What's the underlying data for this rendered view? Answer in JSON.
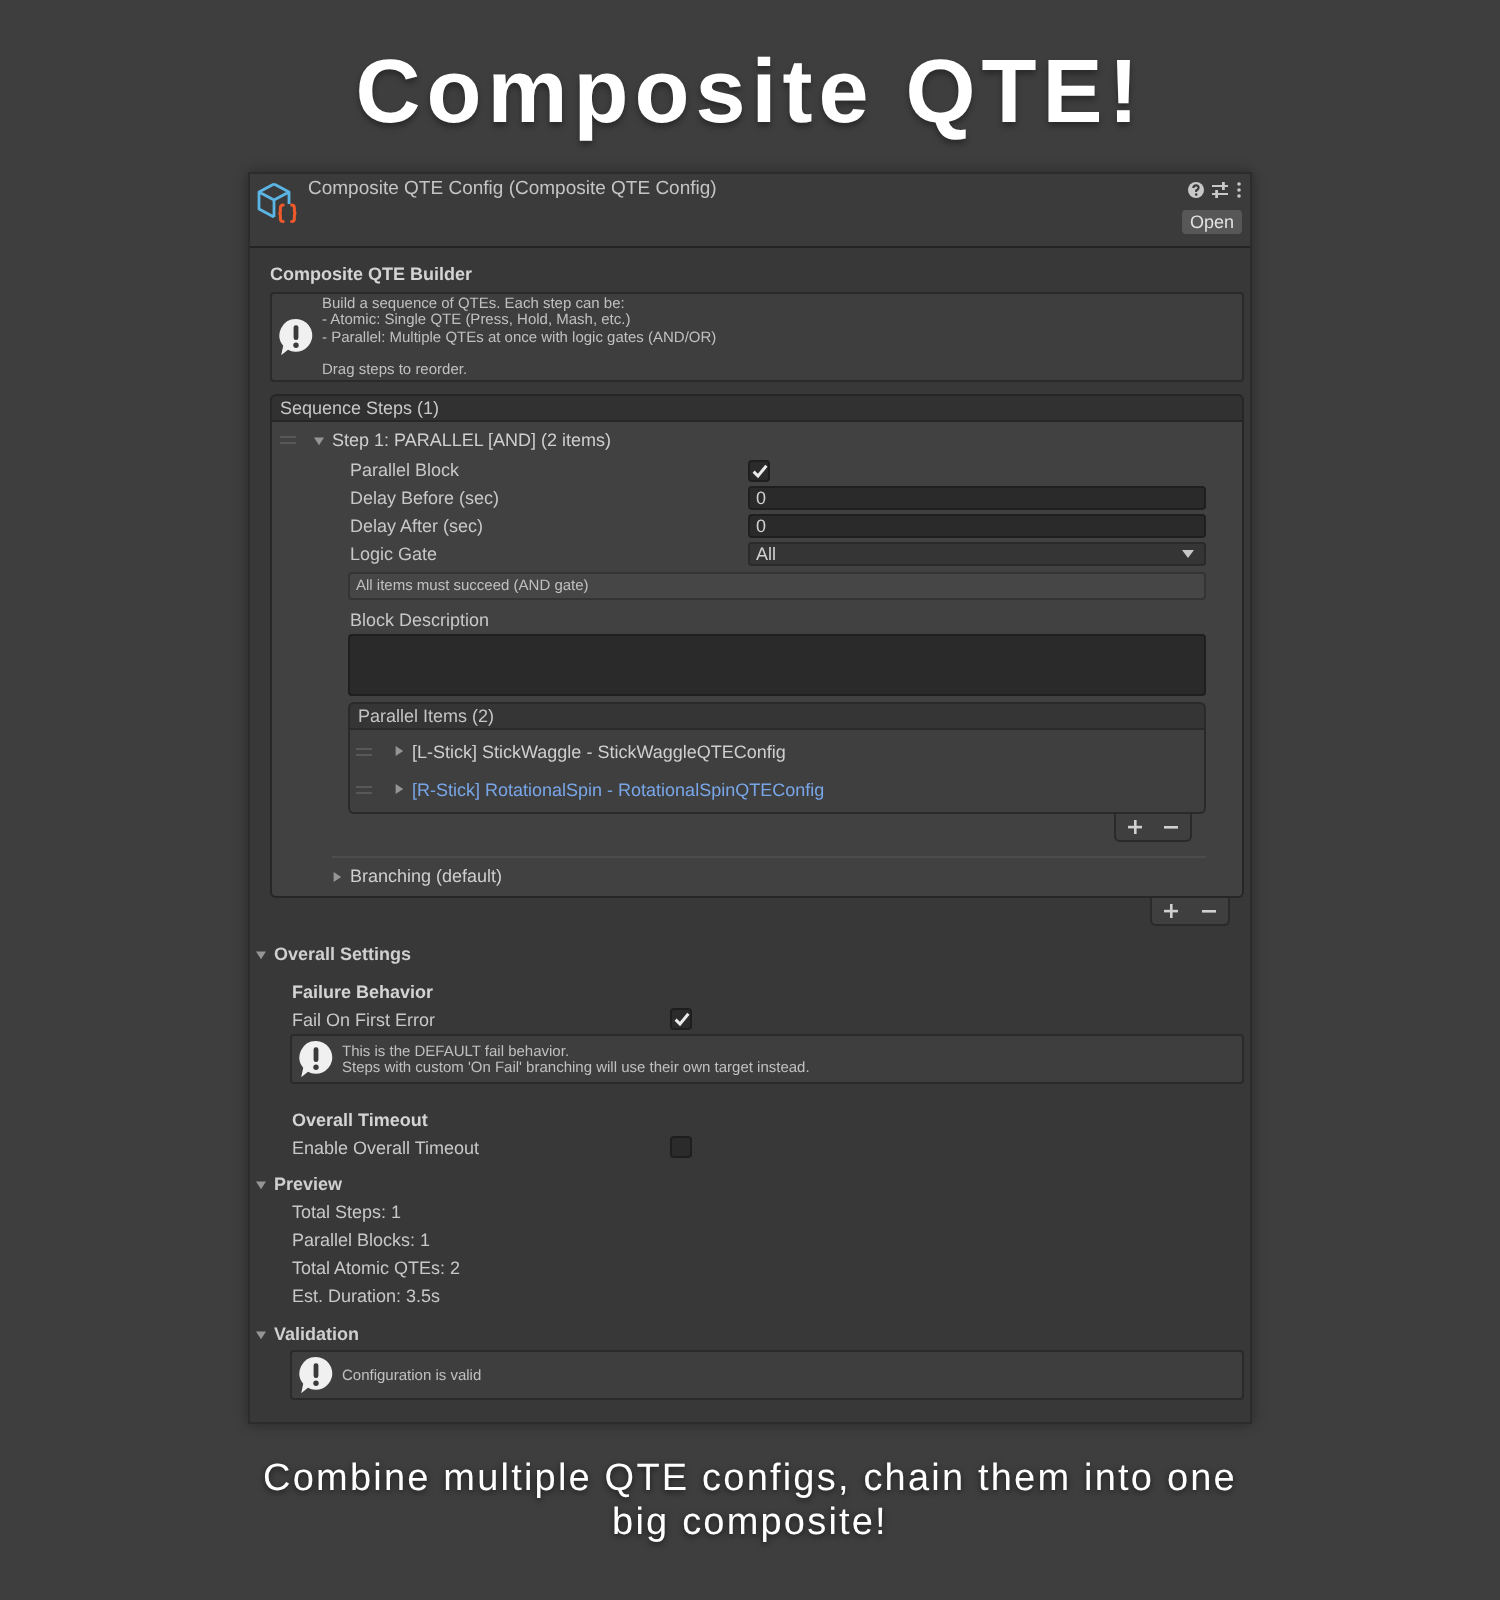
{
  "banner": {
    "title": "Composite QTE!"
  },
  "inspector": {
    "header": {
      "title": "Composite QTE Config (Composite QTE Config)",
      "open_button": "Open"
    },
    "builder": {
      "title": "Composite QTE Builder",
      "help": "Build a sequence of QTEs. Each step can be:\n- Atomic: Single QTE (Press, Hold, Mash, etc.)\n- Parallel: Multiple QTEs at once with logic gates (AND/OR)\n\nDrag steps to reorder."
    },
    "sequence_steps": {
      "header": "Sequence Steps (1)",
      "steps": [
        {
          "title": "Step 1: PARALLEL [AND] (2 items)",
          "expanded": true,
          "fields": [
            {
              "kind": "checkbox",
              "label": "Parallel Block",
              "checked": true
            },
            {
              "kind": "number",
              "label": "Delay Before (sec)",
              "value": "0"
            },
            {
              "kind": "number",
              "label": "Delay After (sec)",
              "value": "0"
            },
            {
              "kind": "dropdown",
              "label": "Logic Gate",
              "value": "All"
            }
          ],
          "gate_note": "All items must succeed (AND gate)",
          "description": {
            "label": "Block Description"
          },
          "parallel_items": {
            "header": "Parallel Items (2)",
            "items": [
              {
                "label": "[L-Stick] StickWaggle - StickWaggleQTEConfig",
                "expanded": false,
                "focused": false
              },
              {
                "label": "[R-Stick] RotationalSpin - RotationalSpinQTEConfig",
                "expanded": false,
                "focused": true
              }
            ]
          },
          "branching": {
            "label": "Branching (default)",
            "expanded": false
          }
        }
      ]
    },
    "sections": [
      {
        "kind": "settings",
        "title": "Overall Settings",
        "expanded": true,
        "groups": [
          {
            "title": "Failure Behavior",
            "fields": [
              {
                "kind": "checkbox",
                "label": "Fail On First Error",
                "checked": true
              }
            ],
            "help": "This is the DEFAULT fail behavior.\nSteps with custom 'On Fail' branching will use their own target instead."
          },
          {
            "title": "Overall Timeout",
            "fields": [
              {
                "kind": "checkbox",
                "label": "Enable Overall Timeout",
                "checked": false
              }
            ]
          }
        ]
      },
      {
        "kind": "stats",
        "title": "Preview",
        "expanded": true,
        "lines": [
          "Total Steps: 1",
          "Parallel Blocks: 1",
          "Total Atomic QTEs: 2",
          "Est. Duration: 3.5s"
        ]
      },
      {
        "kind": "validation",
        "title": "Validation",
        "expanded": true,
        "message": "Configuration is valid"
      }
    ]
  },
  "caption": "Combine multiple QTE configs, chain them into one big composite!"
}
